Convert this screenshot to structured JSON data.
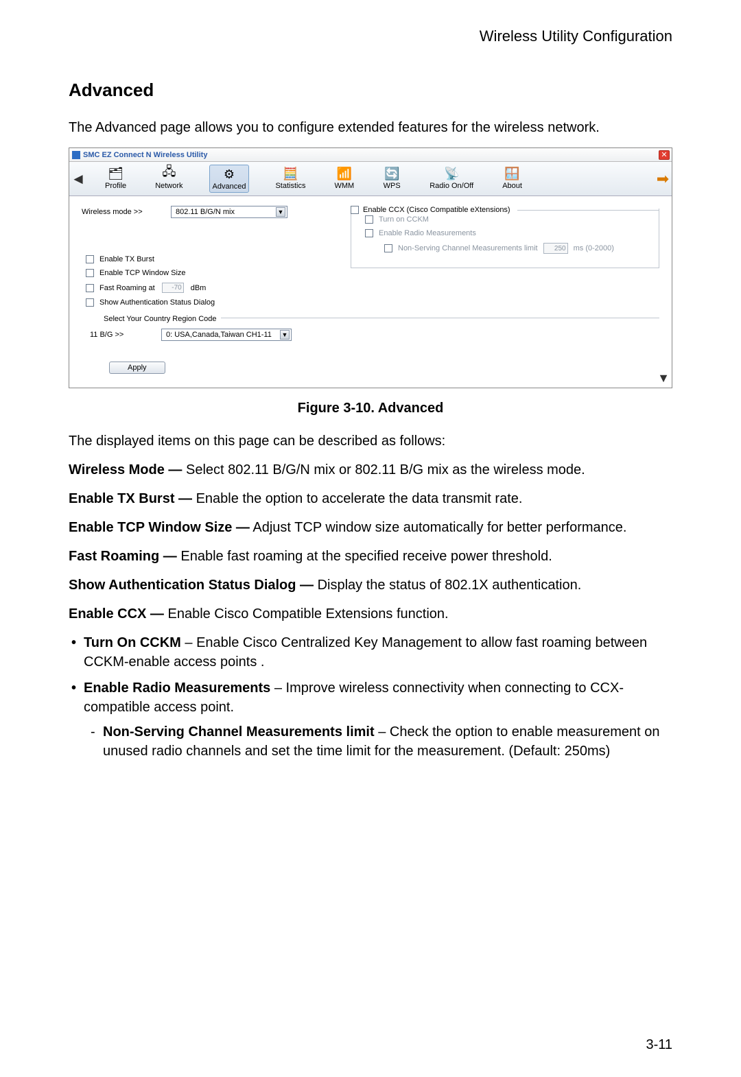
{
  "header": {
    "title": "Wireless Utility Configuration",
    "page_num": "3-11"
  },
  "section": {
    "heading": "Advanced"
  },
  "intro": "The Advanced page allows you to configure extended features for the wireless network.",
  "figure_caption": "Figure 3-10.  Advanced",
  "after_fig": "The displayed items on this page can be described as follows:",
  "desc": {
    "wm_b": "Wireless Mode —",
    "wm_t": " Select 802.11 B/G/N mix or 802.11 B/G mix as the wireless mode.",
    "tx_b": "Enable TX Burst —",
    "tx_t": " Enable the option to accelerate the data transmit rate.",
    "tcp_b": "Enable TCP Window Size —",
    "tcp_t": " Adjust TCP window size automatically for better performance.",
    "fr_b": "Fast Roaming —",
    "fr_t": " Enable fast roaming at the specified receive power threshold.",
    "sa_b": "Show Authentication Status Dialog —",
    "sa_t": "  Display the status of 802.1X authentication.",
    "ccx_b": "Enable CCX —",
    "ccx_t": " Enable Cisco Compatible Extensions function.",
    "b1_b": "Turn On CCKM",
    "b1_t": " – Enable Cisco Centralized Key Management to allow fast roaming between CCKM-enable access points .",
    "b2_b": "Enable Radio Measurements",
    "b2_t": " – Improve wireless connectivity when connecting to CCX-compatible access point.",
    "s1_b": "Non-Serving Channel Measurements limit",
    "s1_t": " – Check the option to enable measurement on unused radio channels and set the time limit for the measurement. (Default: 250ms)"
  },
  "app": {
    "title": "SMC EZ Connect N Wireless Utility",
    "toolbar": {
      "profile": "Profile",
      "network": "Network",
      "advanced": "Advanced",
      "statistics": "Statistics",
      "wmm": "WMM",
      "wps": "WPS",
      "radio": "Radio On/Off",
      "about": "About"
    },
    "wm_label": "Wireless mode >>",
    "wm_value": "802.11 B/G/N mix",
    "ccx_legend": "Enable CCX (Cisco Compatible eXtensions)",
    "cckm": "Turn on CCKM",
    "erm": "Enable Radio Measurements",
    "nscm": "Non-Serving Channel Measurements limit",
    "nscm_val": "250",
    "nscm_unit": "ms (0-2000)",
    "tx": "Enable TX Burst",
    "tcp": "Enable TCP Window Size",
    "fr_pre": "Fast Roaming at",
    "fr_val": "-70",
    "fr_unit": "dBm",
    "auth": "Show Authentication Status Dialog",
    "region_legend": "Select Your Country Region Code",
    "bg_label": "11 B/G >>",
    "bg_value": "0: USA,Canada,Taiwan CH1-11",
    "apply": "Apply"
  }
}
